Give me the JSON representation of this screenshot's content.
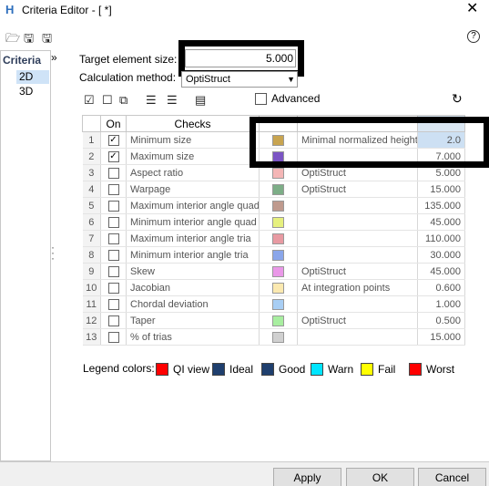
{
  "window": {
    "app_icon": "H",
    "title": "Criteria Editor - [ *]",
    "close_glyph": "✕"
  },
  "toolbar": {
    "icons": [
      "open-folder-icon",
      "save-icon",
      "save-as-icon"
    ],
    "help_glyph": "?"
  },
  "sidebar": {
    "header": "Criteria",
    "items": [
      "2D",
      "3D"
    ],
    "selected": "2D",
    "expand_glyph": "»"
  },
  "form": {
    "target_label": "Target element size:",
    "target_value": "5.000",
    "calc_label": "Calculation method:",
    "calc_value": "OptiStruct"
  },
  "grid_toolbar": {
    "icons": [
      "check-all-icon",
      "uncheck-all-icon",
      "copy-icon",
      "columns-icon",
      "rows-icon",
      "calculator-icon"
    ],
    "advanced_label": "Advanced",
    "advanced_checked": false
  },
  "table": {
    "headers": [
      "",
      "On",
      "Checks",
      "",
      "",
      ""
    ],
    "rows": [
      {
        "num": "1",
        "on": true,
        "check": "Minimum size",
        "color": "#c8a450",
        "extra": "Minimal normalized height",
        "value": "2.0"
      },
      {
        "num": "2",
        "on": true,
        "check": "Maximum size",
        "color": "#7b54c4",
        "extra": "",
        "value": "7.000"
      },
      {
        "num": "3",
        "on": false,
        "check": "Aspect ratio",
        "color": "#f4b6b6",
        "extra": "OptiStruct",
        "value": "5.000"
      },
      {
        "num": "4",
        "on": false,
        "check": "Warpage",
        "color": "#7dae87",
        "extra": "OptiStruct",
        "value": "15.000"
      },
      {
        "num": "5",
        "on": false,
        "check": "Maximum interior angle quad",
        "color": "#bf9a8e",
        "extra": "",
        "value": "135.000"
      },
      {
        "num": "6",
        "on": false,
        "check": "Minimum interior angle quad",
        "color": "#e6f07e",
        "extra": "",
        "value": "45.000"
      },
      {
        "num": "7",
        "on": false,
        "check": "Maximum interior angle tria",
        "color": "#e89aa2",
        "extra": "",
        "value": "110.000"
      },
      {
        "num": "8",
        "on": false,
        "check": "Minimum interior angle tria",
        "color": "#8aa6ea",
        "extra": "",
        "value": "30.000"
      },
      {
        "num": "9",
        "on": false,
        "check": "Skew",
        "color": "#ea98e8",
        "extra": "OptiStruct",
        "value": "45.000"
      },
      {
        "num": "10",
        "on": false,
        "check": "Jacobian",
        "color": "#fbe9b0",
        "extra": "At integration points",
        "value": "0.600"
      },
      {
        "num": "11",
        "on": false,
        "check": "Chordal deviation",
        "color": "#a8cef4",
        "extra": "",
        "value": "1.000"
      },
      {
        "num": "12",
        "on": false,
        "check": "Taper",
        "color": "#a8eea0",
        "extra": "OptiStruct",
        "value": "0.500"
      },
      {
        "num": "13",
        "on": false,
        "check": "% of trias",
        "color": "#d0d0d0",
        "extra": "",
        "value": "15.000"
      }
    ]
  },
  "legend": {
    "title": "Legend colors:",
    "items": [
      {
        "label": "QI view",
        "color": "#ff0000"
      },
      {
        "label": "Ideal",
        "color": "#1f3f6e"
      },
      {
        "label": "Good",
        "color": "#1f3f6e"
      },
      {
        "label": "Warn",
        "color": "#00e5ff"
      },
      {
        "label": "Fail",
        "color": "#ffff00"
      },
      {
        "label": "Worst",
        "color": "#ff0000"
      }
    ]
  },
  "buttons": {
    "apply": "Apply",
    "ok": "OK",
    "cancel": "Cancel"
  }
}
